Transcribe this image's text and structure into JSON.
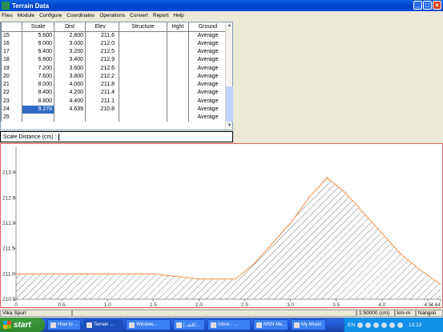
{
  "window": {
    "title": "Terrain Data",
    "min": "_",
    "max": "□",
    "close": "×"
  },
  "menu": [
    "Files",
    "Module",
    "Configure",
    "Coordinates",
    "Operations",
    "Convert",
    "Report",
    "Help"
  ],
  "table": {
    "headers": [
      "",
      "Scale",
      "Dist",
      "Elev",
      "Structure",
      "Hght",
      "Ground"
    ],
    "rows": [
      [
        "15",
        "5.600",
        "2.800",
        "211.6",
        "",
        "",
        "Average"
      ],
      [
        "16",
        "6.000",
        "3.000",
        "212.0",
        "",
        "",
        "Average"
      ],
      [
        "17",
        "6.400",
        "3.200",
        "212.5",
        "",
        "",
        "Average"
      ],
      [
        "18",
        "6.800",
        "3.400",
        "212.9",
        "",
        "",
        "Average"
      ],
      [
        "19",
        "7.200",
        "3.600",
        "212.6",
        "",
        "",
        "Average"
      ],
      [
        "20",
        "7.600",
        "3.800",
        "212.2",
        "",
        "",
        "Average"
      ],
      [
        "21",
        "8.000",
        "4.000",
        "211.8",
        "",
        "",
        "Average"
      ],
      [
        "22",
        "8.400",
        "4.200",
        "211.4",
        "",
        "",
        "Average"
      ],
      [
        "23",
        "8.800",
        "4.400",
        "211.1",
        "",
        "",
        "Average"
      ],
      [
        "24",
        "9.278",
        "4.639",
        "210.8",
        "",
        "",
        "Average"
      ],
      [
        "25",
        "",
        "",
        "",
        "",
        "",
        "Average"
      ]
    ],
    "selected_row": 9
  },
  "scale_field": {
    "label": "Scale Distance (cm) :",
    "value": ""
  },
  "chart_data": {
    "type": "area",
    "x": [
      0,
      0.5,
      1.0,
      1.5,
      2.0,
      2.4,
      2.6,
      2.8,
      3.0,
      3.2,
      3.4,
      3.6,
      3.8,
      4.0,
      4.2,
      4.4,
      4.639
    ],
    "y": [
      211.0,
      211.0,
      211.0,
      211.0,
      210.9,
      210.9,
      211.2,
      211.6,
      212.0,
      212.5,
      212.9,
      212.6,
      212.2,
      211.8,
      211.4,
      211.1,
      210.8
    ],
    "xlim": [
      0,
      4.64
    ],
    "ylim": [
      210.5,
      213.5
    ],
    "xticks": [
      "0",
      "0.5",
      "1.0",
      "1.5",
      "2.0",
      "2.5",
      "3.0",
      "3.5",
      "4.0",
      "4.5",
      "4.64"
    ],
    "xtick_values": [
      0,
      0.5,
      1.0,
      1.5,
      2.0,
      2.5,
      3.0,
      3.5,
      4.0,
      4.5,
      4.64
    ],
    "yticks": [
      "210.5",
      "211.0",
      "211.5",
      "212.0",
      "212.5",
      "213.0"
    ],
    "ytick_values": [
      210.5,
      211.0,
      211.5,
      212.0,
      212.5,
      213.0
    ],
    "line_color": "#ff8c40",
    "fill": "hatched gray"
  },
  "status": {
    "left": "Vika Spuri",
    "scale": "1:50000 (cm)",
    "unit": "km-m",
    "right": "Nangoli"
  },
  "taskbar": {
    "start": "start",
    "tasks": [
      "How to ...",
      "Terrain ...",
      "Window...",
      "| كلشـ...",
      "Inbox - ...",
      "MSN Me...",
      "My Music"
    ],
    "active_task": 1,
    "lang": "EN",
    "clock": "13:13"
  }
}
